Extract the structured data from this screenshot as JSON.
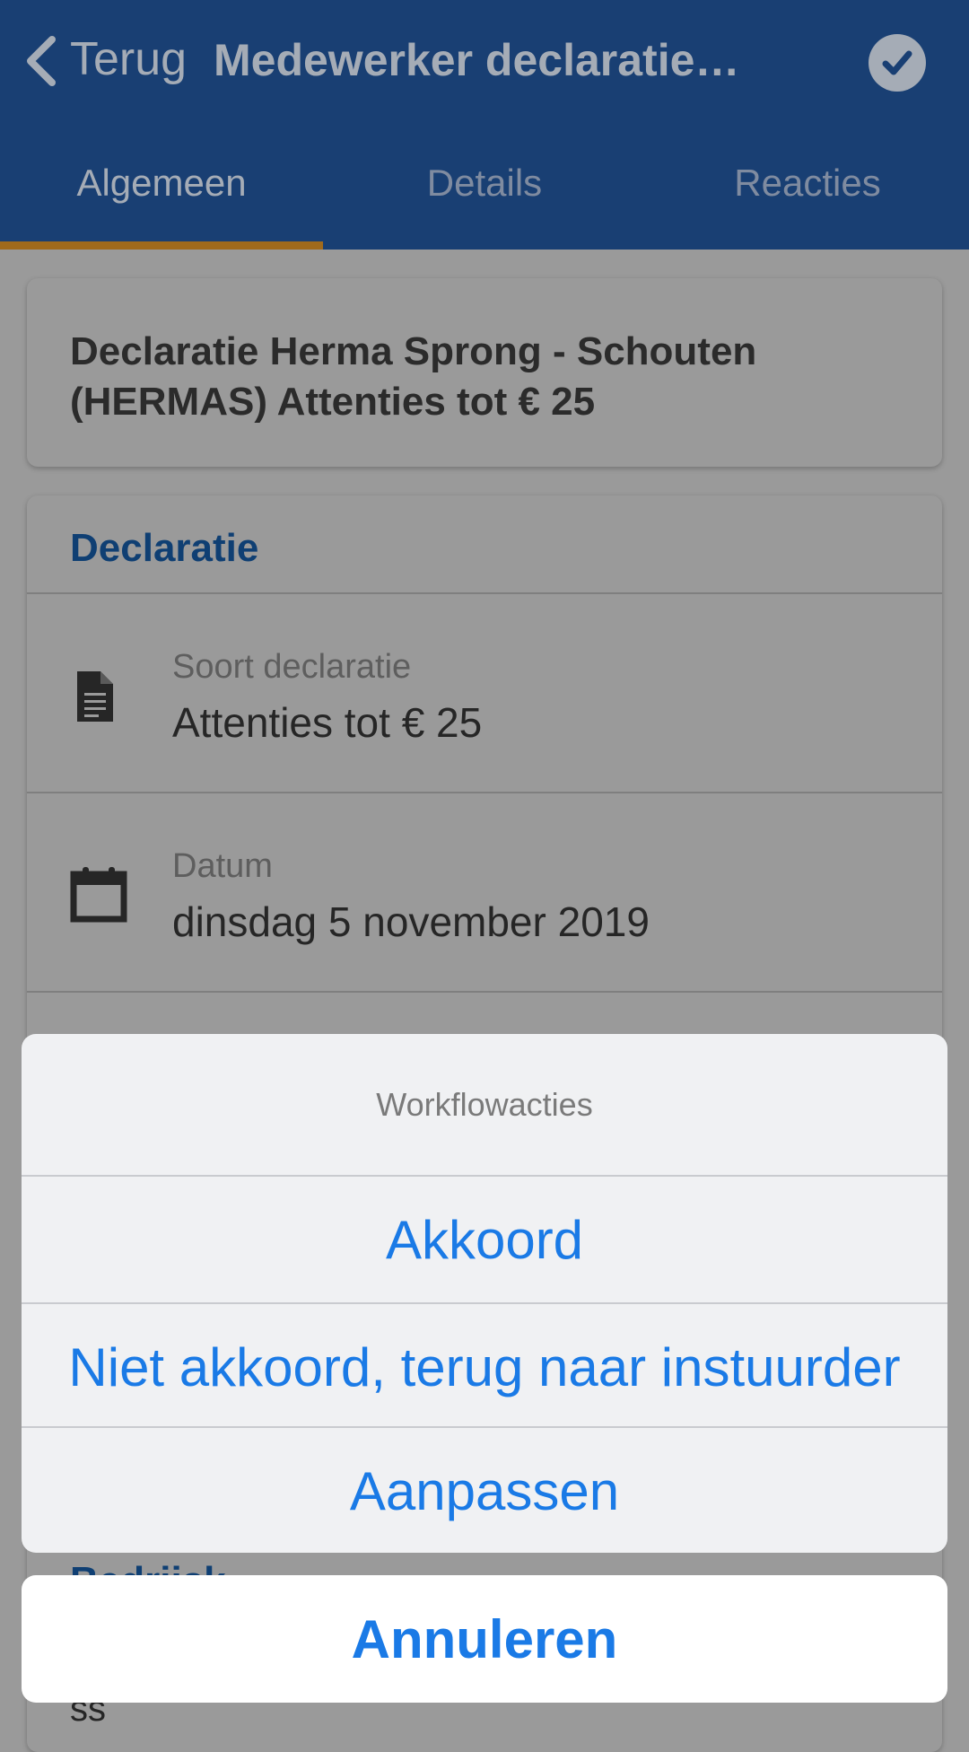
{
  "header": {
    "back_label": "Terug",
    "title": "Medewerker declaratie (P…",
    "confirm_icon": "check-circle-icon"
  },
  "tabs": [
    {
      "label": "Algemeen",
      "active": true
    },
    {
      "label": "Details",
      "active": false
    },
    {
      "label": "Reacties",
      "active": false
    }
  ],
  "summary": {
    "text": "Declaratie Herma Sprong - Schouten (HERMAS) Attenties tot € 25"
  },
  "declaration": {
    "section_title": "Declaratie",
    "fields": [
      {
        "icon": "document-icon",
        "label": "Soort declaratie",
        "value": "Attenties tot € 25"
      },
      {
        "icon": "calendar-icon",
        "label": "Datum",
        "value": "dinsdag 5 november 2019"
      }
    ],
    "partial_section_title": "Bedrijsk",
    "partial_text": "ss"
  },
  "action_sheet": {
    "title": "Workflowacties",
    "actions": [
      "Akkoord",
      "Niet akkoord, terug naar instuurder",
      "Aanpassen"
    ],
    "cancel_label": "Annuleren"
  },
  "colors": {
    "header_bg": "#193f73",
    "tab_indicator": "#a06a1c",
    "action_blue": "#1a7ae6"
  }
}
